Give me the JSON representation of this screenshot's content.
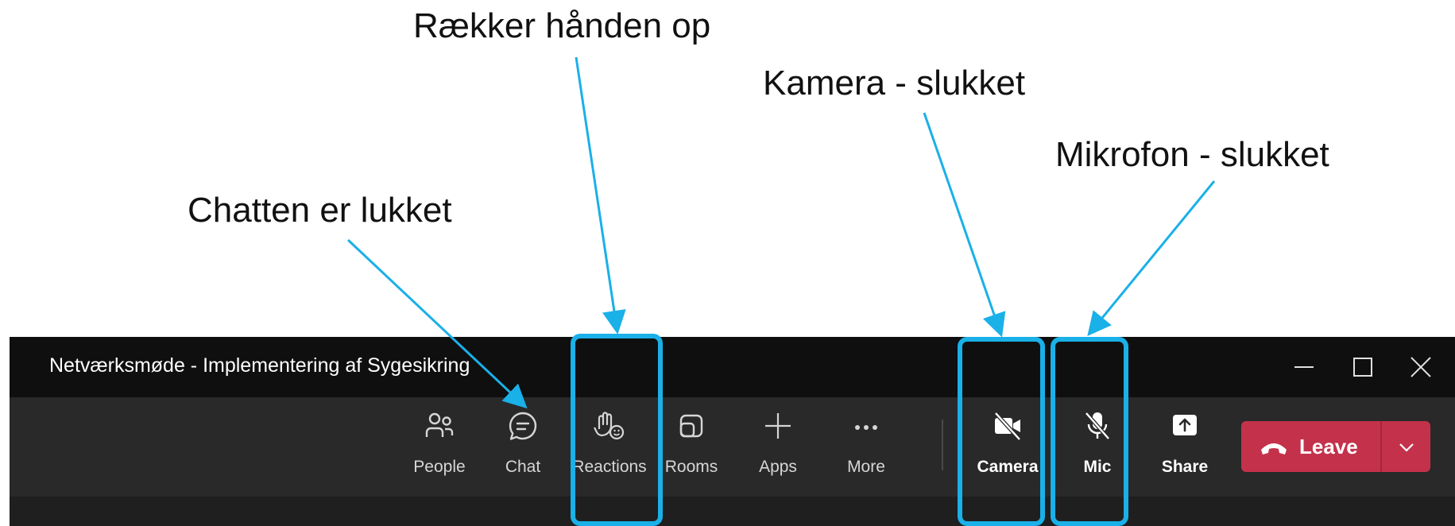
{
  "annotations": {
    "hand": "Rækker hånden op",
    "camera": "Kamera - slukket",
    "mic": "Mikrofon - slukket",
    "chat": "Chatten er lukket"
  },
  "window": {
    "title": "Netværksmøde - Implementering af Sygesikring"
  },
  "toolbar": {
    "people": "People",
    "chat": "Chat",
    "reactions": "Reactions",
    "rooms": "Rooms",
    "apps": "Apps",
    "more": "More",
    "camera": "Camera",
    "mic": "Mic",
    "share": "Share",
    "leave": "Leave"
  },
  "colors": {
    "highlight": "#1ab0e8",
    "leave": "#c4314b",
    "titlebar": "#0f0f0f",
    "toolbar": "#292929"
  },
  "icons": {
    "people": "people-icon",
    "chat": "chat-icon",
    "reactions": "raised-hand-icon",
    "rooms": "rooms-icon",
    "apps": "plus-icon",
    "more": "more-icon",
    "camera": "camera-off-icon",
    "mic": "mic-off-icon",
    "share": "share-icon",
    "leave": "phone-hangup-icon"
  }
}
